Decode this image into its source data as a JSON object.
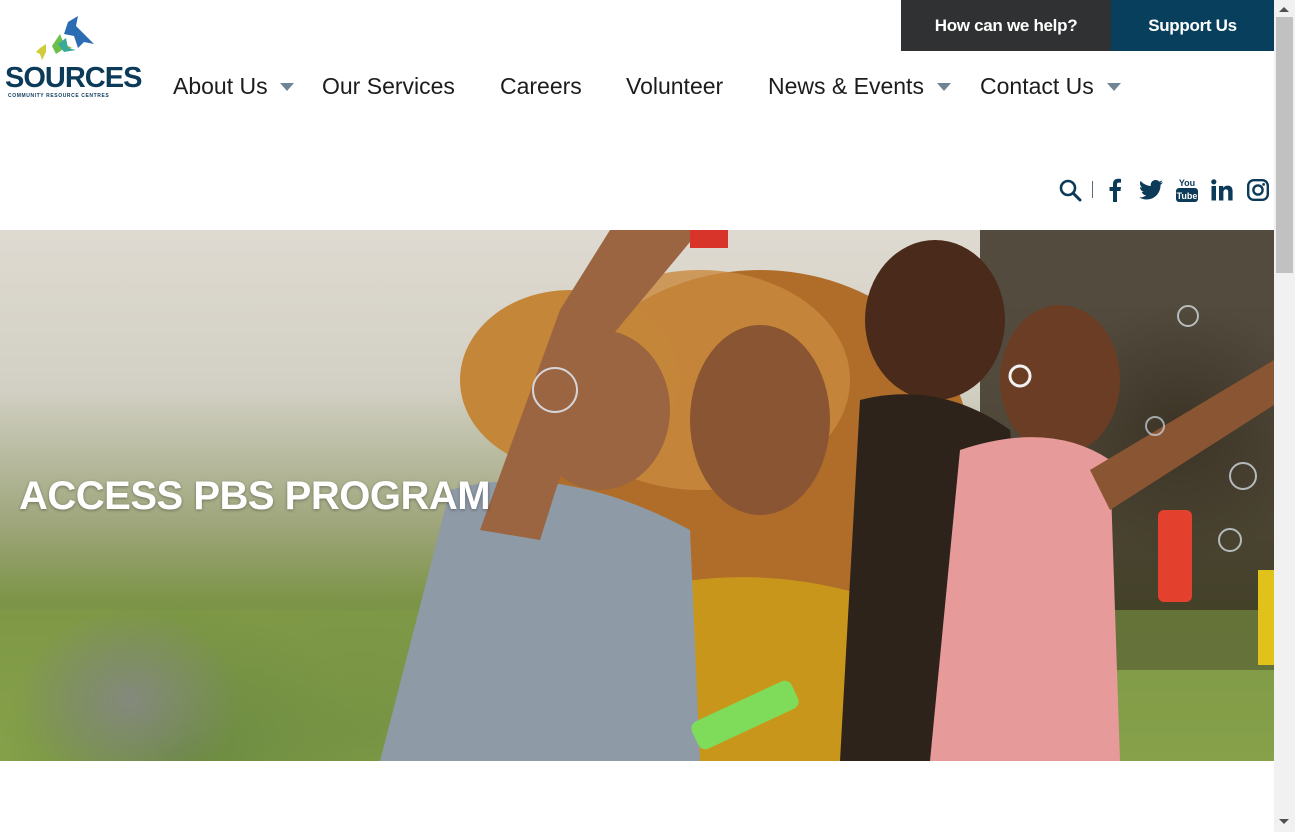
{
  "header": {
    "help_label": "How can we help?",
    "support_label": "Support Us",
    "logo": {
      "wordmark": "SOURCES",
      "tagline": "COMMUNITY RESOURCE CENTRES",
      "colors": {
        "blue_bird": "#2b6cb3",
        "green_bird": "#6cbf4a",
        "yellow_bird": "#d2cc3a",
        "teal_bird": "#3aa99a",
        "wordmark": "#0c3b5a"
      }
    }
  },
  "nav": {
    "items": [
      {
        "label": "About Us",
        "has_dropdown": true
      },
      {
        "label": "Our Services",
        "has_dropdown": false
      },
      {
        "label": "Careers",
        "has_dropdown": false
      },
      {
        "label": "Volunteer",
        "has_dropdown": false
      },
      {
        "label": "News & Events",
        "has_dropdown": true
      },
      {
        "label": "Contact Us",
        "has_dropdown": true
      }
    ]
  },
  "social": {
    "icons": [
      "search-icon",
      "facebook-icon",
      "twitter-icon",
      "youtube-icon",
      "linkedin-icon",
      "instagram-icon"
    ],
    "youtube_top": "You",
    "youtube_bottom": "Tube",
    "icon_color": "#0c3b5a"
  },
  "hero": {
    "title": "ACCESS PBS PROGRAM"
  },
  "colors": {
    "help_bg": "#2f3132",
    "support_bg": "#083f5c",
    "nav_text": "#1c1c1c",
    "caret": "#6f8595"
  }
}
